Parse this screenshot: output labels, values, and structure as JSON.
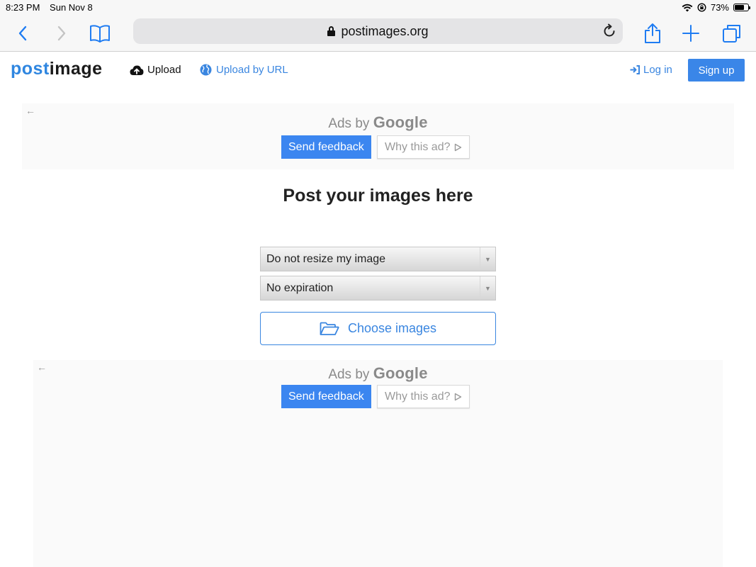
{
  "status_bar": {
    "time": "8:23 PM",
    "date": "Sun Nov 8",
    "battery_percent": "73%",
    "battery_level": 0.73
  },
  "browser": {
    "url": "postimages.org",
    "icons": [
      "back-icon",
      "forward-icon",
      "bookmarks-icon",
      "lock-icon",
      "reload-icon",
      "share-icon",
      "new-tab-icon",
      "tabs-icon"
    ]
  },
  "header": {
    "logo_part1": "post",
    "logo_part2": "image",
    "upload_label": "Upload",
    "upload_url_label": "Upload by URL",
    "login_label": "Log in",
    "signup_label": "Sign up"
  },
  "ads": {
    "ads_by": "Ads by",
    "google": "Google",
    "send_feedback": "Send feedback",
    "why_this_ad": "Why this ad?"
  },
  "main": {
    "title": "Post your images here",
    "resize_select": "Do not resize my image",
    "expiration_select": "No expiration",
    "choose_label": "Choose images"
  },
  "colors": {
    "accent": "#3a86e0",
    "signup_bg": "#3a86e8",
    "feedback_bg": "#3b86f0",
    "ios_blue": "#1f7cf2"
  }
}
